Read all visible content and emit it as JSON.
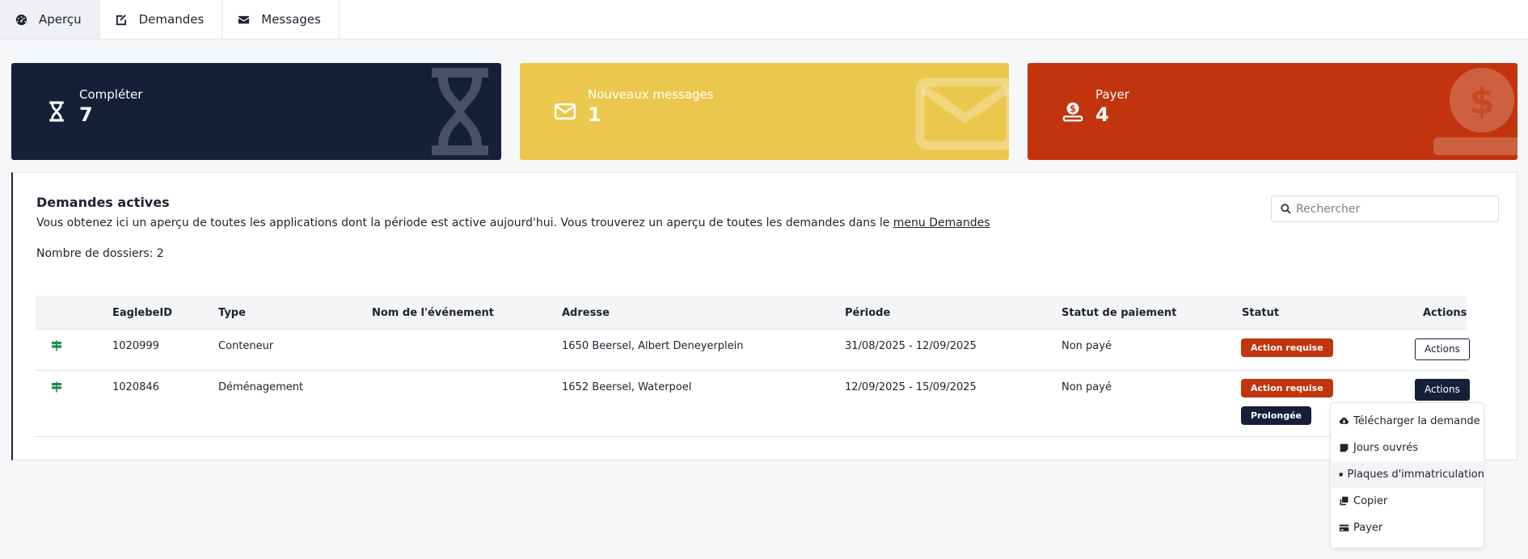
{
  "tabs": [
    {
      "label": "Aperçu",
      "icon": "dashboard-icon",
      "active": true
    },
    {
      "label": "Demandes",
      "icon": "edit-icon",
      "active": false
    },
    {
      "label": "Messages",
      "icon": "envelope-icon",
      "active": false
    }
  ],
  "cards": [
    {
      "label": "Compléter",
      "value": "7",
      "icon": "hourglass-icon",
      "color": "#161f38"
    },
    {
      "label": "Nouveaux messages",
      "value": "1",
      "icon": "envelope-icon",
      "color": "#ebc84d"
    },
    {
      "label": "Payer",
      "value": "4",
      "icon": "hand-coin-icon",
      "color": "#c1340e"
    }
  ],
  "panel": {
    "title": "Demandes actives",
    "description": "Vous obtenez ici un aperçu de toutes les applications dont la période est active aujourd'hui. Vous trouverez un aperçu de toutes les demandes dans le",
    "link": "menu Demandes",
    "count": "Nombre de dossiers: 2",
    "search_placeholder": "Rechercher"
  },
  "table": {
    "headers": [
      "EaglebeID",
      "Type",
      "Nom de l'événement",
      "Adresse",
      "Période",
      "Statut de paiement",
      "Statut",
      "Actions"
    ],
    "rows": [
      {
        "id": "1020999",
        "type": "Conteneur",
        "event": "",
        "address": "1650 Beersel, Albert Deneyerplein",
        "period": "31/08/2025 - 12/09/2025",
        "payment": "Non payé",
        "status": [
          "Action requise"
        ],
        "action": "Actions"
      },
      {
        "id": "1020846",
        "type": "Déménagement",
        "event": "",
        "address": "1652 Beersel, Waterpoel",
        "period": "12/09/2025 - 15/09/2025",
        "payment": "Non payé",
        "status": [
          "Action requise",
          "Prolongée"
        ],
        "action": "Actions"
      }
    ]
  },
  "actions_menu": [
    {
      "label": "Télécharger la demande",
      "icon": "cloud-download-icon"
    },
    {
      "label": "Jours ouvrés",
      "icon": "note-icon"
    },
    {
      "label": "Plaques d'immatriculation",
      "icon": "note-icon"
    },
    {
      "label": "Copier",
      "icon": "copy-icon"
    },
    {
      "label": "Payer",
      "icon": "credit-card-icon"
    }
  ],
  "colors": {
    "navy": "#161f38",
    "yellow": "#ebc84d",
    "red": "#c1340e",
    "row_icon": "#1f8a4c"
  }
}
